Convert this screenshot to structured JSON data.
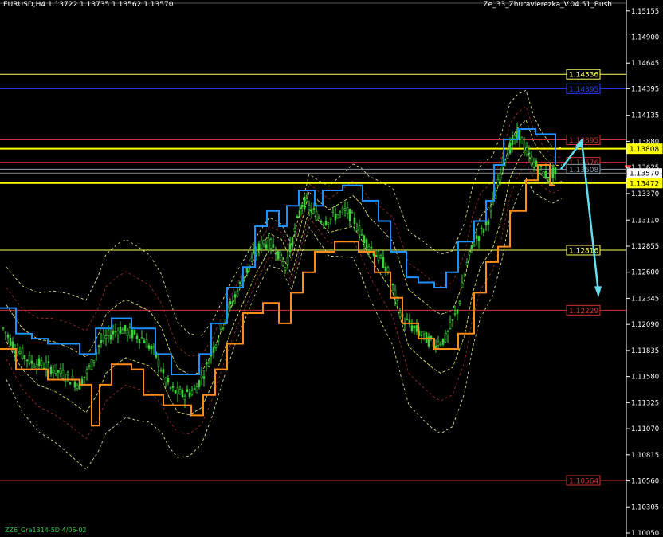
{
  "header": {
    "symbol_info": "EURUSD,H4  1.13722 1.13735 1.13562 1.13570",
    "indicator": "Ze_33_Zhuravlerezka_V.04.51_Bush"
  },
  "footer": {
    "date_label": "ZZ6_Gra1314-5D 4/06-02"
  },
  "colors": {
    "background": "#000000",
    "axis": "#ffffff",
    "candle": "#3cd33c",
    "channel_upper": "#1e90ff",
    "channel_lower": "#ff8c1a",
    "envelope_outer": "#ffff99",
    "envelope_inner": "#b03030",
    "arrow": "#66ddee",
    "bid_line": "#dddddd",
    "ask_marker": "#ff3030"
  },
  "chart_data": {
    "type": "candlestick",
    "ylim": [
      1.1005,
      1.152
    ],
    "y_ticks": [
      "1.15155",
      "1.14900",
      "1.14645",
      "1.14395",
      "1.14135",
      "1.13880",
      "1.13625",
      "1.13370",
      "1.13110",
      "1.12855",
      "1.12600",
      "1.12345",
      "1.12090",
      "1.11835",
      "1.11580",
      "1.11325",
      "1.11070",
      "1.10815",
      "1.10560",
      "1.10305",
      "1.10050"
    ],
    "current_price": {
      "label": "1.13570",
      "value": 1.1357
    },
    "levels": [
      {
        "label": "1.14536",
        "value": 1.14536,
        "color": "#ffff66",
        "bold": false
      },
      {
        "label": "1.14395",
        "value": 1.14395,
        "color": "#2a3fff",
        "bold": false
      },
      {
        "label": "1.13895",
        "value": 1.13895,
        "color": "#cc3333",
        "bold": false
      },
      {
        "label": "1.13808",
        "value": 1.13808,
        "color": "#ffff00",
        "bold": true
      },
      {
        "label": "1.13676",
        "value": 1.13676,
        "color": "#cc3333",
        "bold": false
      },
      {
        "label": "1.13608",
        "value": 1.13608,
        "color": "#8899aa",
        "bold": false
      },
      {
        "label": "1.13472",
        "value": 1.13472,
        "color": "#ffff00",
        "bold": true
      },
      {
        "label": "1.12816",
        "value": 1.12816,
        "color": "#ffff66",
        "bold": false
      },
      {
        "label": "1.12229",
        "value": 1.12229,
        "color": "#cc3333",
        "bold": false
      },
      {
        "label": "1.10564",
        "value": 1.10564,
        "color": "#cc3333",
        "bold": false
      }
    ],
    "price_path": [
      [
        0,
        1.121
      ],
      [
        20,
        1.1185
      ],
      [
        40,
        1.1172
      ],
      [
        60,
        1.1168
      ],
      [
        80,
        1.116
      ],
      [
        100,
        1.115
      ],
      [
        115,
        1.117
      ],
      [
        125,
        1.119
      ],
      [
        140,
        1.12
      ],
      [
        150,
        1.1205
      ],
      [
        165,
        1.12
      ],
      [
        180,
        1.1195
      ],
      [
        195,
        1.118
      ],
      [
        205,
        1.116
      ],
      [
        215,
        1.1145
      ],
      [
        230,
        1.114
      ],
      [
        245,
        1.1145
      ],
      [
        258,
        1.1165
      ],
      [
        270,
        1.119
      ],
      [
        285,
        1.122
      ],
      [
        300,
        1.1245
      ],
      [
        315,
        1.127
      ],
      [
        330,
        1.129
      ],
      [
        345,
        1.1285
      ],
      [
        358,
        1.1265
      ],
      [
        370,
        1.13
      ],
      [
        380,
        1.133
      ],
      [
        392,
        1.132
      ],
      [
        405,
        1.131
      ],
      [
        420,
        1.1315
      ],
      [
        435,
        1.132
      ],
      [
        445,
        1.131
      ],
      [
        455,
        1.1295
      ],
      [
        465,
        1.1285
      ],
      [
        475,
        1.1275
      ],
      [
        485,
        1.1265
      ],
      [
        495,
        1.124
      ],
      [
        505,
        1.1215
      ],
      [
        520,
        1.1205
      ],
      [
        535,
        1.1195
      ],
      [
        545,
        1.119
      ],
      [
        560,
        1.1195
      ],
      [
        575,
        1.1225
      ],
      [
        585,
        1.1265
      ],
      [
        595,
        1.129
      ],
      [
        610,
        1.1305
      ],
      [
        622,
        1.1335
      ],
      [
        632,
        1.137
      ],
      [
        642,
        1.1385
      ],
      [
        652,
        1.1395
      ],
      [
        662,
        1.1375
      ],
      [
        672,
        1.1365
      ],
      [
        685,
        1.1355
      ],
      [
        697,
        1.1357
      ]
    ],
    "channel_upper": [
      [
        0,
        1.1225
      ],
      [
        20,
        1.1225
      ],
      [
        20,
        1.12
      ],
      [
        40,
        1.12
      ],
      [
        40,
        1.1195
      ],
      [
        60,
        1.1195
      ],
      [
        60,
        1.119
      ],
      [
        100,
        1.119
      ],
      [
        100,
        1.118
      ],
      [
        120,
        1.118
      ],
      [
        120,
        1.1205
      ],
      [
        140,
        1.1205
      ],
      [
        140,
        1.1215
      ],
      [
        165,
        1.1215
      ],
      [
        165,
        1.1205
      ],
      [
        195,
        1.1205
      ],
      [
        195,
        1.118
      ],
      [
        215,
        1.118
      ],
      [
        215,
        1.116
      ],
      [
        250,
        1.116
      ],
      [
        250,
        1.118
      ],
      [
        265,
        1.118
      ],
      [
        265,
        1.121
      ],
      [
        285,
        1.121
      ],
      [
        285,
        1.1245
      ],
      [
        305,
        1.1245
      ],
      [
        305,
        1.1265
      ],
      [
        320,
        1.1265
      ],
      [
        320,
        1.1305
      ],
      [
        335,
        1.1305
      ],
      [
        335,
        1.132
      ],
      [
        350,
        1.132
      ],
      [
        350,
        1.1305
      ],
      [
        360,
        1.1305
      ],
      [
        360,
        1.1325
      ],
      [
        375,
        1.1325
      ],
      [
        375,
        1.134
      ],
      [
        395,
        1.134
      ],
      [
        395,
        1.1325
      ],
      [
        405,
        1.1325
      ],
      [
        405,
        1.134
      ],
      [
        430,
        1.134
      ],
      [
        430,
        1.1345
      ],
      [
        455,
        1.1345
      ],
      [
        455,
        1.133
      ],
      [
        475,
        1.133
      ],
      [
        475,
        1.131
      ],
      [
        490,
        1.131
      ],
      [
        490,
        1.128
      ],
      [
        510,
        1.128
      ],
      [
        510,
        1.1255
      ],
      [
        525,
        1.1255
      ],
      [
        525,
        1.125
      ],
      [
        545,
        1.125
      ],
      [
        545,
        1.1245
      ],
      [
        560,
        1.1245
      ],
      [
        560,
        1.126
      ],
      [
        575,
        1.126
      ],
      [
        575,
        1.129
      ],
      [
        595,
        1.129
      ],
      [
        595,
        1.131
      ],
      [
        610,
        1.131
      ],
      [
        610,
        1.133
      ],
      [
        620,
        1.133
      ],
      [
        620,
        1.1365
      ],
      [
        632,
        1.1365
      ],
      [
        632,
        1.139
      ],
      [
        650,
        1.139
      ],
      [
        650,
        1.14
      ],
      [
        672,
        1.14
      ],
      [
        672,
        1.1395
      ],
      [
        697,
        1.1395
      ],
      [
        697,
        1.1365
      ]
    ],
    "channel_lower": [
      [
        0,
        1.1185
      ],
      [
        20,
        1.1185
      ],
      [
        20,
        1.1165
      ],
      [
        60,
        1.1165
      ],
      [
        60,
        1.1155
      ],
      [
        100,
        1.1155
      ],
      [
        100,
        1.115
      ],
      [
        115,
        1.115
      ],
      [
        115,
        1.111
      ],
      [
        125,
        1.111
      ],
      [
        125,
        1.115
      ],
      [
        140,
        1.115
      ],
      [
        140,
        1.117
      ],
      [
        165,
        1.117
      ],
      [
        165,
        1.1165
      ],
      [
        180,
        1.1165
      ],
      [
        180,
        1.114
      ],
      [
        205,
        1.114
      ],
      [
        205,
        1.113
      ],
      [
        240,
        1.113
      ],
      [
        240,
        1.112
      ],
      [
        255,
        1.112
      ],
      [
        255,
        1.114
      ],
      [
        270,
        1.114
      ],
      [
        270,
        1.1165
      ],
      [
        285,
        1.1165
      ],
      [
        285,
        1.119
      ],
      [
        305,
        1.119
      ],
      [
        305,
        1.122
      ],
      [
        330,
        1.122
      ],
      [
        330,
        1.123
      ],
      [
        350,
        1.123
      ],
      [
        350,
        1.121
      ],
      [
        365,
        1.121
      ],
      [
        365,
        1.124
      ],
      [
        380,
        1.124
      ],
      [
        380,
        1.126
      ],
      [
        395,
        1.126
      ],
      [
        395,
        1.128
      ],
      [
        420,
        1.128
      ],
      [
        420,
        1.129
      ],
      [
        450,
        1.129
      ],
      [
        450,
        1.128
      ],
      [
        470,
        1.128
      ],
      [
        470,
        1.126
      ],
      [
        490,
        1.126
      ],
      [
        490,
        1.1235
      ],
      [
        505,
        1.1235
      ],
      [
        505,
        1.121
      ],
      [
        525,
        1.121
      ],
      [
        525,
        1.1195
      ],
      [
        545,
        1.1195
      ],
      [
        545,
        1.1185
      ],
      [
        575,
        1.1185
      ],
      [
        575,
        1.12
      ],
      [
        595,
        1.12
      ],
      [
        595,
        1.124
      ],
      [
        610,
        1.124
      ],
      [
        610,
        1.127
      ],
      [
        625,
        1.127
      ],
      [
        625,
        1.1285
      ],
      [
        640,
        1.1285
      ],
      [
        640,
        1.132
      ],
      [
        660,
        1.132
      ],
      [
        660,
        1.135
      ],
      [
        675,
        1.135
      ],
      [
        675,
        1.1365
      ],
      [
        690,
        1.1365
      ],
      [
        690,
        1.1345
      ],
      [
        697,
        1.1345
      ]
    ],
    "envelopes": [
      {
        "role": "outer",
        "offset": 0.0055,
        "dash": "3,3"
      },
      {
        "role": "inner",
        "offset": 0.0035,
        "dash": "3,3"
      },
      {
        "role": "mid",
        "offset": 0.0018,
        "dash": "4,2"
      }
    ],
    "forecast_arrow": {
      "points": [
        [
          1.1361
        ],
        [
          1.1388
        ],
        [
          1.124
        ]
      ]
    }
  }
}
